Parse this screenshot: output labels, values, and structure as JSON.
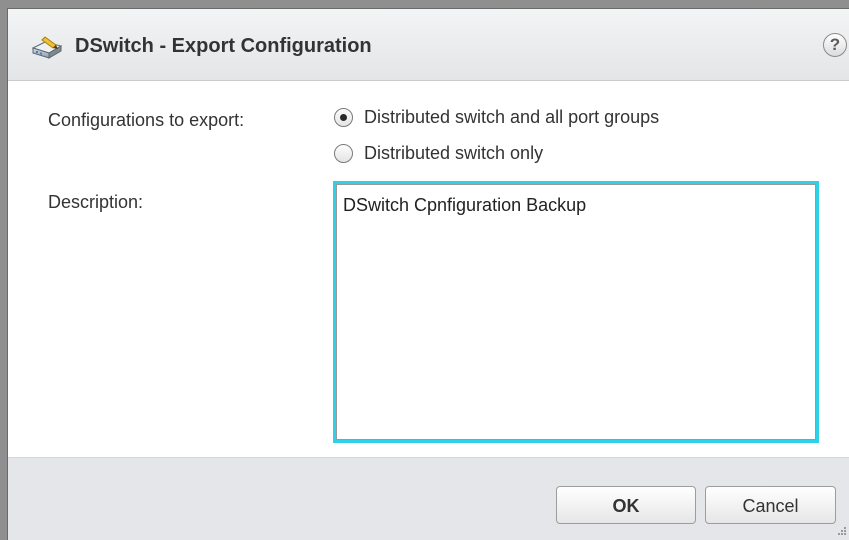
{
  "dialog": {
    "title": "DSwitch - Export Configuration",
    "help_icon": "help-icon",
    "help_glyph": "?",
    "title_icon": "distributed-switch-export-icon"
  },
  "form": {
    "configurations_label": "Configurations to export:",
    "options": [
      {
        "label": "Distributed switch and all port groups",
        "selected": true
      },
      {
        "label": "Distributed switch only",
        "selected": false
      }
    ],
    "description_label": "Description:",
    "description_value": "DSwitch Cpnfiguration Backup"
  },
  "footer": {
    "ok_label": "OK",
    "cancel_label": "Cancel"
  },
  "colors": {
    "focus_border": "#2ed2e6",
    "footer_bg": "#e4e6e9",
    "titlebar_bg": "#e7e9eb"
  }
}
